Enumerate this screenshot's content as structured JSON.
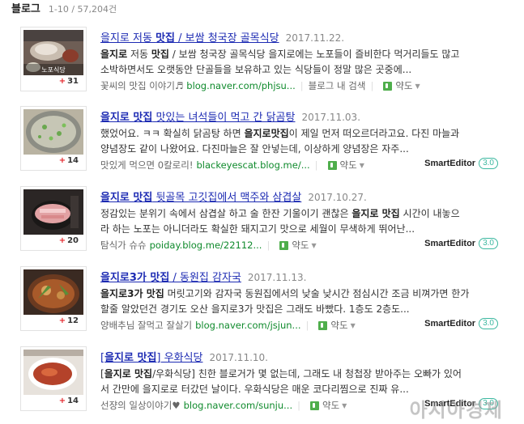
{
  "header": {
    "section": "블로그",
    "count": "1-10 / 57,204건"
  },
  "items": [
    {
      "thumb_overlay": "노포식당",
      "likes": "31",
      "title_pre": "을지로 저동 ",
      "title_bold": "맛집",
      "title_post": " / 보쌈 청국장 골목식당",
      "date": "2017.11.22.",
      "line1_pre": "",
      "line1_bold1": "을지로",
      "line1_mid": " 저동 ",
      "line1_bold2": "맛집",
      "line1_post": " / 보쌈 청국장 골목식당 을지로에는 노포들이 즐비한다 먹거리들도 많고",
      "line2": "소박하면서도 오랫동안 단골들을 보유하고 있는 식당들이 정말 많은 곳중에...",
      "blogname": "꽃씨의 맛집 이야기♬",
      "url": "blog.naver.com/phjsu...",
      "inblog": "블로그 내 검색",
      "map": "약도",
      "smarteditor": ""
    },
    {
      "thumb_overlay": "",
      "likes": "14",
      "title_pre": "",
      "title_bold": "을지로 맛집",
      "title_post": " 맛있는 녀석들이 먹고 간 닭곰탕",
      "date": "2017.11.03.",
      "line1_pre": "했었어요. ㅋㅋ 확실히 닭곰탕 하면 ",
      "line1_bold1": "을지로맛집",
      "line1_mid": "",
      "line1_bold2": "",
      "line1_post": "이 제일 먼저 떠오르더라고요. 다진 마늘과",
      "line2": "양념장도 같이 나왔어요. 다진마늘은 잘 안넣는데, 이상하게 양념장은 자주...",
      "blogname": "맛있게 먹으면 0칼로리!",
      "url": "blackeyescat.blog.me/...",
      "inblog": "",
      "map": "약도",
      "smarteditor": "SmartEditor"
    },
    {
      "thumb_overlay": "",
      "likes": "20",
      "title_pre": "",
      "title_bold": "을지로 맛집",
      "title_post": " 뒷골목 고깃집에서 맥주와 삼겹살",
      "date": "2017.10.27.",
      "line1_pre": "정감있는 분위기 속에서 삼겹살 하고 술 한잔 기울이기 괜찮은 ",
      "line1_bold1": "을지로 맛집",
      "line1_mid": "",
      "line1_bold2": "",
      "line1_post": " 시간이 내놓으",
      "line2": "라 하는 노포는 아니더라도 확실한 돼지고기 맛으로 세월이 무색하게 뛰어난...",
      "blogname": "탐식가 슈슈",
      "url": "poiday.blog.me/22112...",
      "inblog": "",
      "map": "약도",
      "smarteditor": "SmartEditor"
    },
    {
      "thumb_overlay": "",
      "likes": "12",
      "title_pre": "",
      "title_bold": "을지로3가 맛집",
      "title_post": " / 동원집 감자국",
      "date": "2017.11.13.",
      "line1_pre": "",
      "line1_bold1": "을지로3가 맛집",
      "line1_mid": "",
      "line1_bold2": "",
      "line1_post": " 머릿고기와 감자국 동원집에서의 낮술 낮시간 점심시간 조금 비껴가면 한가",
      "line2": "할줄 알았던건 경기도 오산 을지로3가 맛집은 그래도 바빴다. 1층도 2층도...",
      "blogname": "양배추님 잘먹고 잘살기",
      "url": "blog.naver.com/jsjun...",
      "inblog": "",
      "map": "약도",
      "smarteditor": "SmartEditor"
    },
    {
      "thumb_overlay": "",
      "likes": "14",
      "title_pre": "[",
      "title_bold": "을지로 맛집",
      "title_post": "] 우화식당",
      "date": "2017.11.10.",
      "line1_pre": "[",
      "line1_bold1": "을지로 맛집",
      "line1_mid": "",
      "line1_bold2": "",
      "line1_post": "/우화식당] 친한 블로거가 몇 없는데, 그래도 내 청첩장 받아주는 오빠가 있어",
      "line2": "서 간만에 을지로로 터갔던 날이다. 우화식당은 매운 코다리찜으로 진짜 유...",
      "blogname": "선쟝의 일상이야기♥",
      "url": "blog.naver.com/sunju...",
      "inblog": "",
      "map": "약도",
      "smarteditor": "SmartEditor"
    }
  ],
  "smarteditor_version": "3.0",
  "watermark": "아시아경제"
}
